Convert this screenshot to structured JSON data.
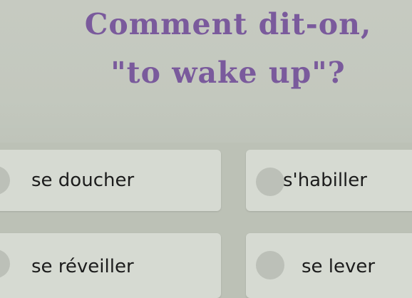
{
  "question": {
    "line1": "Comment dit-on,",
    "line2": "\"to wake up\"?"
  },
  "options": [
    {
      "label": "se doucher"
    },
    {
      "label": "s'habiller"
    },
    {
      "label": "se réveiller"
    },
    {
      "label": "se lever"
    }
  ],
  "colors": {
    "question_text": "#7a5a9c",
    "option_background": "#d6dad2",
    "page_background": "#c9cdc4"
  }
}
